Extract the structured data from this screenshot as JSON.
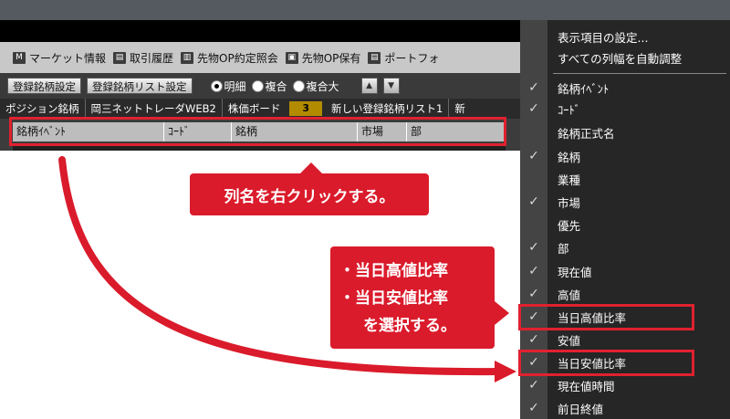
{
  "toolbar": {
    "items": [
      {
        "icon": "M",
        "label": "マーケット情報"
      },
      {
        "icon": "▤",
        "label": "取引履歴"
      },
      {
        "icon": "▥",
        "label": "先物OP約定照会"
      },
      {
        "icon": "▣",
        "label": "先物OP保有"
      },
      {
        "icon": "▤",
        "label": "ポートフォ"
      }
    ]
  },
  "controls": {
    "register_btn": "登録銘柄設定",
    "register_list_btn": "登録銘柄リスト設定",
    "radios": [
      "明細",
      "複合",
      "複合大"
    ],
    "up_arrow": "▲",
    "down_arrow": "▼"
  },
  "tabs": {
    "t1": "ポジション銘柄",
    "t2": "岡三ネットトレーダWEB2",
    "t3": "株価ボード",
    "count": "3",
    "t4": "新しい登録銘柄リスト1",
    "t5": "新"
  },
  "columns": [
    "銘柄ｲﾍﾞﾝﾄ",
    "ｺｰﾄﾞ",
    "銘柄",
    "市場",
    "部"
  ],
  "menu": {
    "top": [
      "表示項目の設定...",
      "すべての列幅を自動調整"
    ],
    "items": [
      {
        "label": "銘柄ｲﾍﾞﾝﾄ",
        "checked": true
      },
      {
        "label": "ｺｰﾄﾞ",
        "checked": true
      },
      {
        "label": "銘柄正式名",
        "checked": false
      },
      {
        "label": "銘柄",
        "checked": true
      },
      {
        "label": "業種",
        "checked": false
      },
      {
        "label": "市場",
        "checked": true
      },
      {
        "label": "優先",
        "checked": false
      },
      {
        "label": "部",
        "checked": true
      },
      {
        "label": "現在値",
        "checked": true
      },
      {
        "label": "高値",
        "checked": true
      },
      {
        "label": "当日高値比率",
        "checked": true
      },
      {
        "label": "安値",
        "checked": true
      },
      {
        "label": "当日安値比率",
        "checked": true
      },
      {
        "label": "現在値時間",
        "checked": true
      },
      {
        "label": "前日終値",
        "checked": true
      }
    ]
  },
  "callouts": {
    "right_click": "列名を右クリックする。",
    "select_line1": "・当日高値比率",
    "select_line2": "・当日安値比率",
    "select_line3": "を選択する。"
  },
  "colors": {
    "accent_red": "#da1b2b",
    "frame_red": "#e0212f"
  }
}
